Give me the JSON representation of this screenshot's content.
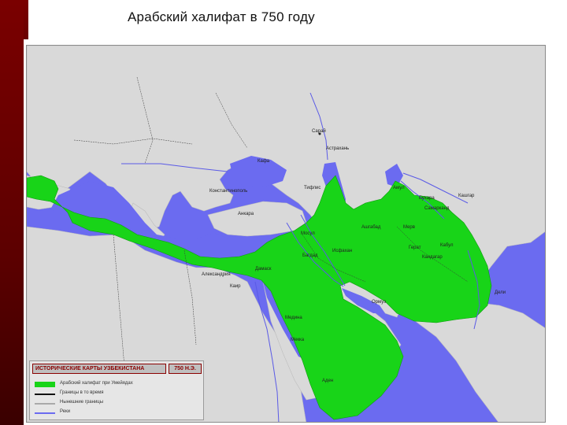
{
  "slide": {
    "title": "Арабский халифат в 750 году"
  },
  "colors": {
    "frame_red": "#7a0000",
    "sea": "#6b6bf0",
    "land": "#d9d9d9",
    "caliphate": "#18d418",
    "borders": "#3a3a3a"
  },
  "map": {
    "labels": [
      {
        "name": "city-sarai",
        "text": "Сарай"
      },
      {
        "name": "city-astrakhan",
        "text": "Астрахань"
      },
      {
        "name": "city-kafa",
        "text": "Кафа"
      },
      {
        "name": "city-constantinople",
        "text": "Константинополь"
      },
      {
        "name": "city-tiflis",
        "text": "Тифлис"
      },
      {
        "name": "city-ankara",
        "text": "Анкара"
      },
      {
        "name": "city-amul",
        "text": "Амул"
      },
      {
        "name": "city-bukhara",
        "text": "Бухара"
      },
      {
        "name": "city-samarkand",
        "text": "Самарканд"
      },
      {
        "name": "city-merv",
        "text": "Мерв"
      },
      {
        "name": "city-herat",
        "text": "Герат"
      },
      {
        "name": "city-kabul",
        "text": "Кабул"
      },
      {
        "name": "city-kandahar",
        "text": "Кандагар"
      },
      {
        "name": "city-isfahan",
        "text": "Исфахан"
      },
      {
        "name": "city-bagdad",
        "text": "Багдад"
      },
      {
        "name": "city-damascus",
        "text": "Дамаск"
      },
      {
        "name": "city-alexandria",
        "text": "Александрия"
      },
      {
        "name": "city-cairo",
        "text": "Каир"
      },
      {
        "name": "city-hormuz",
        "text": "Ормуз"
      },
      {
        "name": "city-medina",
        "text": "Медина"
      },
      {
        "name": "city-mecca",
        "text": "Мекка"
      },
      {
        "name": "city-aden",
        "text": "Аден"
      },
      {
        "name": "city-delhi",
        "text": "Дели"
      },
      {
        "name": "city-mosul",
        "text": "Мосул"
      },
      {
        "name": "city-ashgabat",
        "text": "Ашгабад"
      },
      {
        "name": "city-kashgar",
        "text": "Кашгар"
      }
    ]
  },
  "legend": {
    "header": "ИСТОРИЧЕСКИЕ КАРТЫ УЗБЕКИСТАНА",
    "year": "750 Н.Э.",
    "items": [
      {
        "label": "Арабский халифат при Умейядах",
        "color": "#18d418",
        "kind": "area"
      },
      {
        "label": "Границы в то время",
        "color": "#111111",
        "kind": "line"
      },
      {
        "label": "Нынешние границы",
        "color": "#aaaaaa",
        "kind": "line"
      },
      {
        "label": "Реки",
        "color": "#6b6bf0",
        "kind": "line"
      }
    ]
  }
}
